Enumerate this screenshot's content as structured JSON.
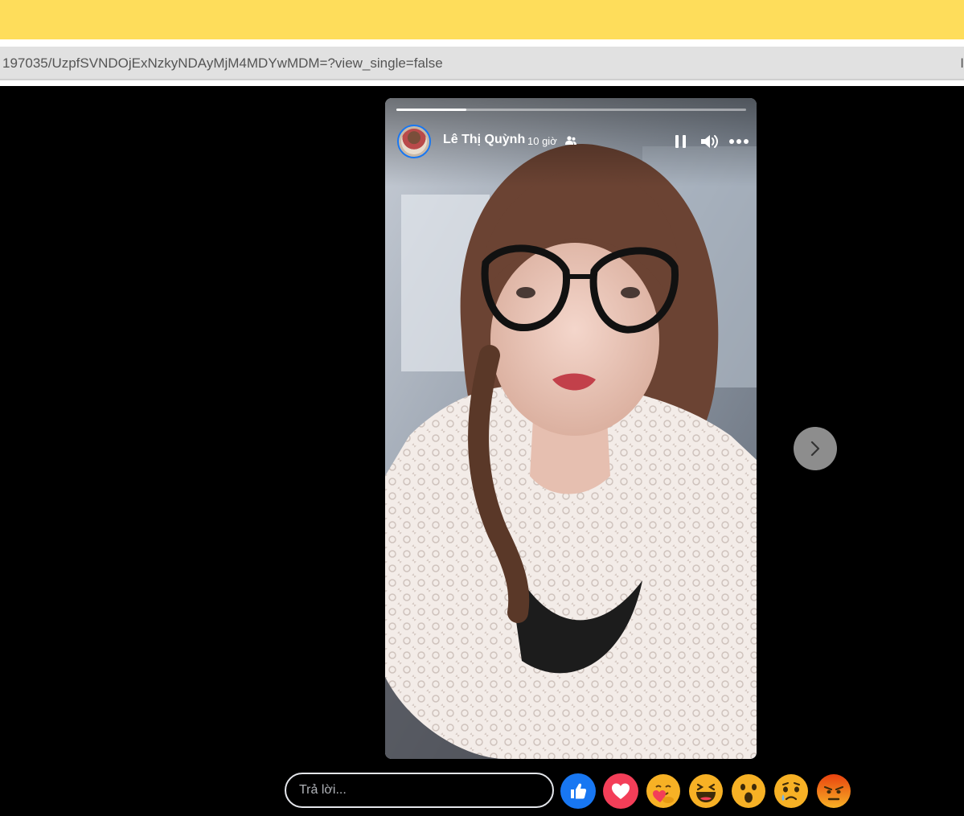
{
  "browser": {
    "url": "197035/UzpfSVNDOjExNzkyNDAyMjM4MDYwMDM=?view_single=false",
    "url_end": "I"
  },
  "story": {
    "user_name": "Lê Thị Quỳnh",
    "time": "10 giờ",
    "audience_icon": "friends-icon",
    "progress": 0.2,
    "controls": [
      "pause-icon",
      "volume-icon",
      "more-icon"
    ]
  },
  "reply": {
    "placeholder": "Trả lời..."
  },
  "reactions": [
    "like",
    "love",
    "care",
    "haha",
    "wow",
    "sad",
    "angry"
  ],
  "colors": {
    "topbar": "#fedd5b",
    "like": "#1877f2",
    "love": "#f33e58",
    "emoji": "#f7b125",
    "angry": "#e9710f"
  }
}
